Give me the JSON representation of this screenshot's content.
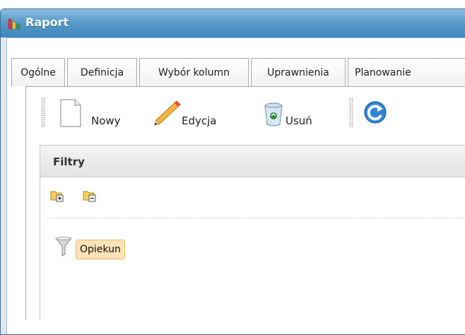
{
  "window": {
    "title": "Raport"
  },
  "tabs": [
    {
      "label": "Ogólne"
    },
    {
      "label": "Definicja"
    },
    {
      "label": "Wybór kolumn"
    },
    {
      "label": "Uprawnienia"
    },
    {
      "label": "Planowanie"
    }
  ],
  "toolbar": {
    "new_label": "Nowy",
    "edit_label": "Edycja",
    "delete_label": "Usuń",
    "refresh_icon": "refresh-icon"
  },
  "filters": {
    "title": "Filtry",
    "nodes": [
      {
        "label": "Opiekun"
      }
    ]
  },
  "colors": {
    "titlebar": "#4a8fc3",
    "selection": "#fce3b7"
  }
}
